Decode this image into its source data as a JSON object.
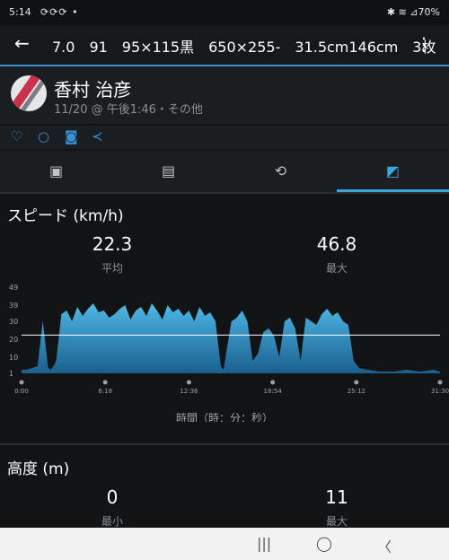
{
  "status": {
    "time": "5:14",
    "icons": "⟳⟳⟳ •",
    "right": "✱ ≋ ⊿70%"
  },
  "topbar": {
    "back_icon": "←",
    "title": "7.0　91　95×115黒　650×255-　31.5cm146cm　3枚",
    "more_icon": "⋮"
  },
  "activity": {
    "user_name": "香村 治彦",
    "meta": "11/20 @ 午後1:46・その他"
  },
  "actions": {
    "like_icon": "♡",
    "comment_icon": "○",
    "photo_icon": "◙",
    "share_icon": "≺"
  },
  "tabs": [
    {
      "name": "tab-photos",
      "icon": "▣"
    },
    {
      "name": "tab-details",
      "icon": "▤"
    },
    {
      "name": "tab-laps",
      "icon": "⟲"
    },
    {
      "name": "tab-charts",
      "icon": "◩"
    }
  ],
  "speed": {
    "title": "スピード (km/h)",
    "avg_value": "22.3",
    "avg_label": "平均",
    "max_value": "46.8",
    "max_label": "最大",
    "xlabel": "時間（時：分：秒）"
  },
  "elevation": {
    "title": "高度 (m)",
    "min_value": "0",
    "min_label": "最小",
    "max_value": "11",
    "max_label": "最大"
  },
  "nav": {
    "recent": "|||",
    "home": "◯",
    "back": "〈"
  },
  "colors": {
    "accent": "#3aa8e0",
    "area_top": "#4fb8e6",
    "area_bottom": "#1a5f8e"
  },
  "chart_data": {
    "type": "area",
    "title": "スピード (km/h)",
    "xlabel": "時間（時：分：秒）",
    "ylabel": "",
    "yticks": [
      1,
      10,
      20,
      30,
      39,
      49
    ],
    "ylim": [
      1,
      49
    ],
    "xticks": [
      "0:00",
      "6:18",
      "12:36",
      "18:54",
      "25:12",
      "31:30"
    ],
    "xlim_minutes": [
      0,
      31.5
    ],
    "avg_line": 22.3,
    "series": [
      {
        "x": [
          0,
          0.4,
          0.8,
          1.2,
          1.6,
          2.0,
          2.2,
          2.4,
          2.6,
          3.0,
          3.4,
          3.8,
          4.2,
          4.6,
          5.0,
          5.4,
          5.8,
          6.2,
          6.6,
          7.0,
          7.4,
          7.8,
          8.2,
          8.6,
          9.0,
          9.4,
          9.8,
          10.2,
          10.6,
          11.0,
          11.4,
          11.8,
          12.2,
          12.6,
          13.0,
          13.4,
          13.8,
          14.2,
          14.6,
          15.0,
          15.2,
          15.4,
          15.8,
          16.2,
          16.6,
          17.0,
          17.4,
          17.8,
          18.2,
          18.6,
          19.0,
          19.4,
          19.8,
          20.2,
          20.6,
          21.0,
          21.4,
          21.8,
          22.2,
          22.6,
          23.0,
          23.4,
          23.8,
          24.2,
          24.6,
          25.0,
          25.4,
          26.0,
          27.0,
          28.0,
          29.0,
          30.0,
          31.0,
          31.5
        ],
        "y": [
          3,
          3,
          4,
          5,
          30,
          4,
          3,
          5,
          8,
          34,
          36,
          30,
          38,
          33,
          37,
          40,
          35,
          36,
          32,
          34,
          37,
          39,
          31,
          36,
          38,
          33,
          40,
          36,
          31,
          39,
          35,
          37,
          33,
          36,
          30,
          38,
          33,
          35,
          30,
          5,
          3,
          12,
          30,
          32,
          36,
          30,
          8,
          12,
          24,
          26,
          22,
          10,
          30,
          32,
          26,
          8,
          32,
          30,
          28,
          34,
          37,
          33,
          35,
          30,
          28,
          8,
          4,
          3,
          2,
          2,
          3,
          2,
          3,
          2
        ]
      }
    ]
  }
}
